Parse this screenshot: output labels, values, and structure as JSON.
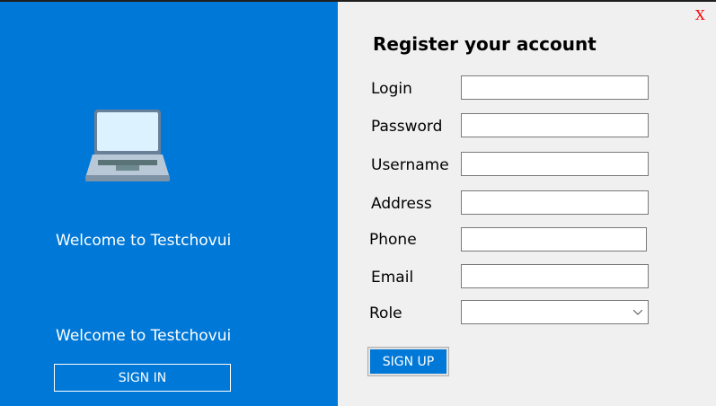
{
  "left_panel": {
    "icon": "laptop-icon",
    "welcome_primary": "Welcome to Testchovui",
    "welcome_secondary": "Welcome to Testchovui",
    "sign_in_label": "SIGN IN"
  },
  "form": {
    "close_label": "X",
    "title": "Register your account",
    "fields": [
      {
        "label": "Login",
        "value": ""
      },
      {
        "label": "Password",
        "value": ""
      },
      {
        "label": "Username",
        "value": ""
      },
      {
        "label": "Address",
        "value": ""
      },
      {
        "label": "Phone",
        "value": ""
      },
      {
        "label": "Email",
        "value": ""
      }
    ],
    "role": {
      "label": "Role",
      "selected": ""
    },
    "sign_up_label": "SIGN UP"
  },
  "colors": {
    "accent": "#0078d7",
    "close": "#ff0000"
  }
}
